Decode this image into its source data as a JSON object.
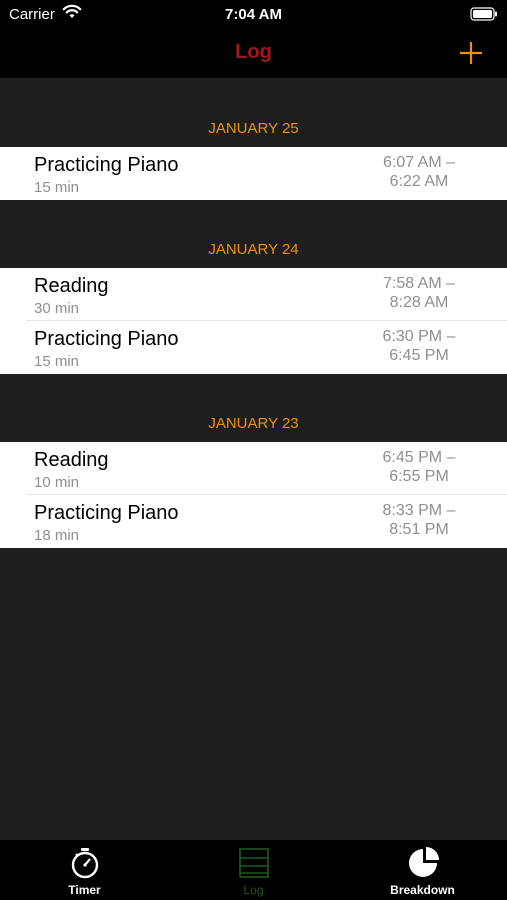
{
  "status_bar": {
    "carrier": "Carrier",
    "time": "7:04 AM"
  },
  "nav": {
    "title": "Log"
  },
  "sections": [
    {
      "header": "JANUARY 25",
      "rows": [
        {
          "activity": "Practicing Piano",
          "duration": "15 min",
          "start": "6:07 AM –",
          "end": "6:22 AM"
        }
      ]
    },
    {
      "header": "JANUARY 24",
      "rows": [
        {
          "activity": "Reading",
          "duration": "30 min",
          "start": "7:58 AM –",
          "end": "8:28 AM"
        },
        {
          "activity": "Practicing Piano",
          "duration": "15 min",
          "start": "6:30 PM –",
          "end": "6:45 PM"
        }
      ]
    },
    {
      "header": "JANUARY 23",
      "rows": [
        {
          "activity": "Reading",
          "duration": "10 min",
          "start": "6:45 PM –",
          "end": "6:55 PM"
        },
        {
          "activity": "Practicing Piano",
          "duration": "18 min",
          "start": "8:33 PM –",
          "end": "8:51 PM"
        }
      ]
    }
  ],
  "tabs": [
    {
      "label": "Timer",
      "icon": "stopwatch-icon",
      "selected": false
    },
    {
      "label": "Log",
      "icon": "list-icon",
      "selected": true
    },
    {
      "label": "Breakdown",
      "icon": "pie-chart-icon",
      "selected": false
    }
  ],
  "colors": {
    "accent": "#f0900a",
    "title": "#a01a1a",
    "selected_tab": "#1f5a1f"
  }
}
